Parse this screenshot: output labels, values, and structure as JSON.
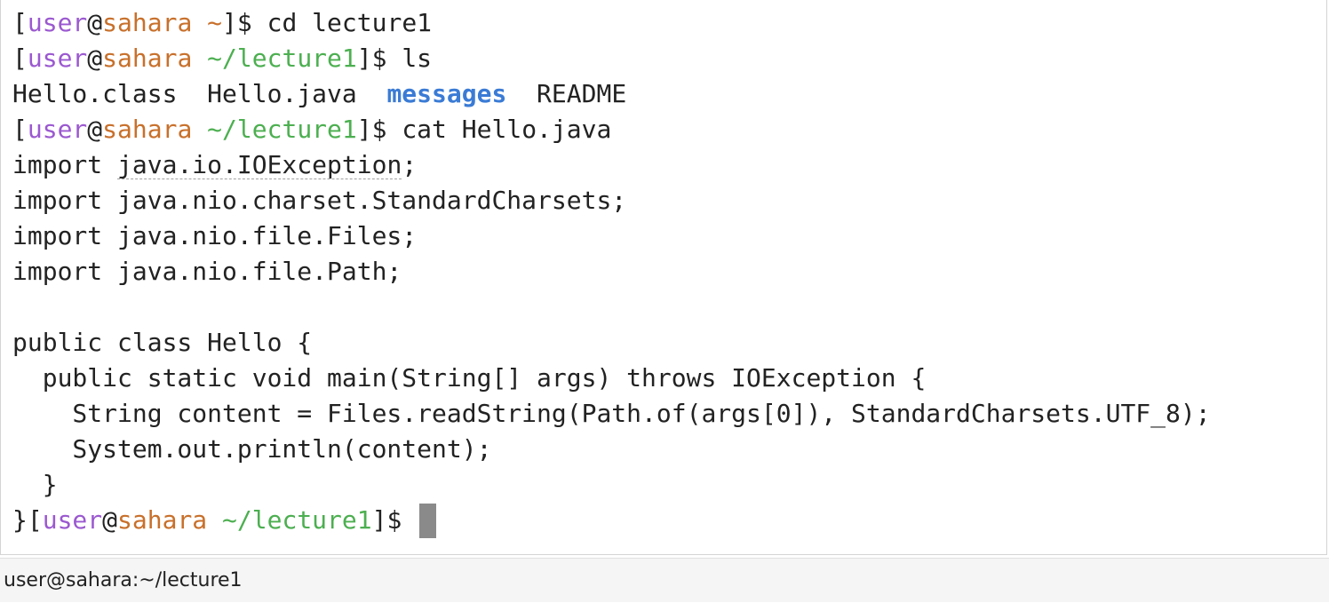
{
  "terminal": {
    "prompt1": {
      "open": "[",
      "user": "user",
      "at": "@",
      "host": "sahara",
      "sp": " ",
      "path": "~",
      "close": "]$ ",
      "command": "cd lecture1"
    },
    "prompt2": {
      "open": "[",
      "user": "user",
      "at": "@",
      "host": "sahara",
      "sp": " ",
      "path": "~/lecture1",
      "close": "]$ ",
      "command": "ls"
    },
    "ls_output": {
      "file1": "Hello.class",
      "file2": "Hello.java",
      "dir1": "messages",
      "file3": "README"
    },
    "prompt3": {
      "open": "[",
      "user": "user",
      "at": "@",
      "host": "sahara",
      "sp": " ",
      "path": "~/lecture1",
      "close": "]$ ",
      "command": "cat Hello.java"
    },
    "code": {
      "line1_kw": "import ",
      "line1_pkg": "java.io.IOException",
      "line1_end": ";",
      "line2": "import java.nio.charset.StandardCharsets;",
      "line3": "import java.nio.file.Files;",
      "line4": "import java.nio.file.Path;",
      "line5": "",
      "line6": "public class Hello {",
      "line7": "  public static void main(String[] args) throws IOException {",
      "line8": "    String content = Files.readString(Path.of(args[0]), StandardCharsets.UTF_8);",
      "line9": "    System.out.println(content);",
      "line10": "  }",
      "line11_brace": "}"
    },
    "prompt4": {
      "open": "[",
      "user": "user",
      "at": "@",
      "host": "sahara",
      "sp": " ",
      "path": "~/lecture1",
      "close": "]$ "
    }
  },
  "statusbar": {
    "title": "user@sahara:~/lecture1"
  },
  "colors": {
    "user": "#9b59d0",
    "host": "#c8702b",
    "path": "#4caf50",
    "directory": "#3a7bd5",
    "cursor": "#8a8a8a"
  }
}
